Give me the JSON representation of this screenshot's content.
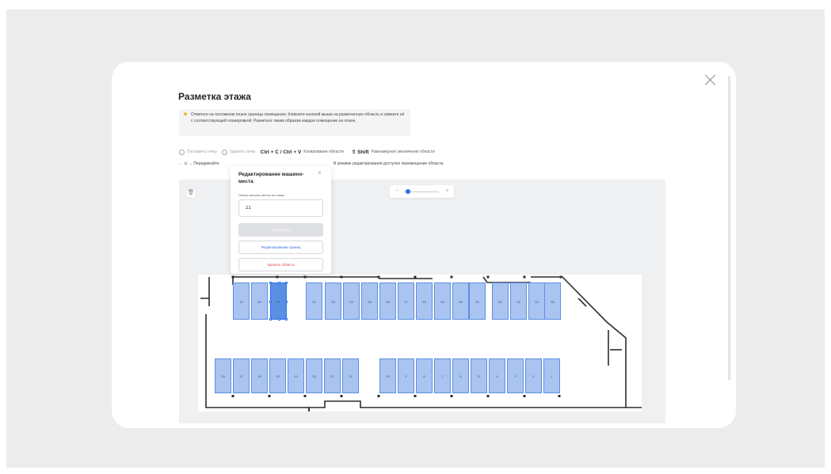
{
  "modal": {
    "title": "Разметка этажа",
    "info": "Отметьте на поэтажном плане границы помещения. Кликните кнопкой мыши на размеченную область и свяжите её с соответствующей планировкой. Разметьте таким образом каждое помещение на плане."
  },
  "toolbar": {
    "set_point": "Поставить точку",
    "delete_point": "Удалить точку",
    "copy_keys": "Ctrl + C / Ctrl + V",
    "copy_label": "Копирование области",
    "shift_key": "⇧ Shift",
    "shift_label": "Равномерное увеличение области",
    "move_keys": "← ⊙ →",
    "move_label": "Передвигайте",
    "edit_mode_hint": "В режиме редактирования доступно перемещение области."
  },
  "zoom": {
    "minus": "–",
    "plus": "+",
    "level": 0.1
  },
  "popup": {
    "title": "Редактирование машино-места",
    "close": "×",
    "field_label": "Номер машино-места на этаже",
    "field_value": "21",
    "save": "Сохранить",
    "edit_bounds": "Редактирование границ",
    "delete": "Удалить область"
  },
  "spots_top": [
    "19",
    "20",
    "21",
    "22",
    "23",
    "24",
    "25",
    "26",
    "27",
    "28",
    "29",
    "30",
    "31",
    "32",
    "33",
    "34",
    "35"
  ],
  "spots_bottom": [
    "18",
    "17",
    "16",
    "15",
    "14",
    "13",
    "12",
    "11",
    "10",
    "9",
    "8",
    "7",
    "6",
    "5",
    "4",
    "3",
    "2",
    "1"
  ],
  "selected_spot": "21",
  "colors": {
    "spot": "#a9c4f0",
    "spot_border": "#5d8fe0",
    "selected": "#5b8fe4",
    "accent": "#2f6fe4",
    "danger": "#e04646"
  }
}
